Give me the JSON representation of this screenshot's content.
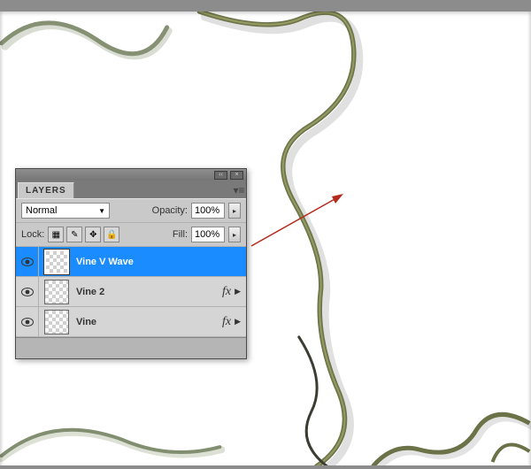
{
  "panel": {
    "title": "LAYERS",
    "blendMode": "Normal",
    "opacityLabel": "Opacity:",
    "opacityValue": "100%",
    "lockLabel": "Lock:",
    "fillLabel": "Fill:",
    "fillValue": "100%",
    "lockIcons": [
      "transparency-lock-icon",
      "brush-lock-icon",
      "move-lock-icon",
      "all-lock-icon"
    ],
    "layers": [
      {
        "name": "Vine V Wave",
        "selected": true,
        "fx": false,
        "visible": true
      },
      {
        "name": "Vine 2",
        "selected": false,
        "fx": true,
        "visible": true
      },
      {
        "name": "Vine",
        "selected": false,
        "fx": true,
        "visible": true
      }
    ],
    "fxIndicator": "fx"
  },
  "colors": {
    "selection": "#1a8cff",
    "arrow": "#b52a1e",
    "vineGreen": "#8a8b4d",
    "vinePale": "#d5dcc9"
  }
}
